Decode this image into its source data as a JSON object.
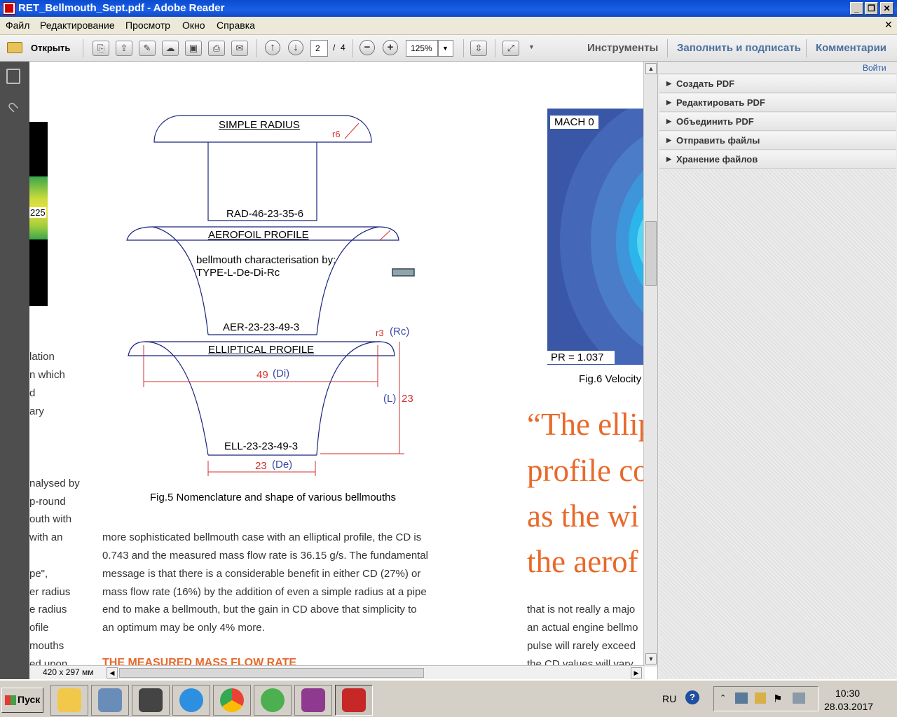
{
  "window": {
    "title": "RET_Bellmouth_Sept.pdf - Adobe Reader",
    "controls": {
      "minimize": "_",
      "restore": "❐",
      "close": "✕"
    }
  },
  "menu": [
    "Файл",
    "Редактирование",
    "Просмотр",
    "Окно",
    "Справка"
  ],
  "toolbar": {
    "open_label": "Открыть",
    "page_current": "2",
    "page_sep": "/",
    "page_total": "4",
    "zoom": "125%",
    "tools_label": "Инструменты",
    "fill_sign_label": "Заполнить и подписать",
    "comments_label": "Комментарии"
  },
  "right_pane": {
    "signin": "Войти",
    "items": [
      "Создать PDF",
      "Редактировать PDF",
      "Объединить PDF",
      "Отправить файлы",
      "Хранение файлов"
    ]
  },
  "document": {
    "left_partial_lines": [
      "lation",
      "n which",
      "d",
      "ary",
      "nalysed by",
      "p-round",
      "outh with",
      "with an",
      "pe\",",
      "er radius",
      "e radius",
      "ofile",
      "mouths",
      "ed upon"
    ],
    "colorbar_label": "225",
    "figure5": {
      "simple_radius": "SIMPLE RADIUS",
      "r6": "r6",
      "rad_code": "RAD-46-23-35-6",
      "aerofoil": "AEROFOIL PROFILE",
      "char_line1": "bellmouth characterisation by:",
      "char_line2": "TYPE-L-De-Di-Rc",
      "aer_code": "AER-23-23-49-3",
      "elliptical": "ELLIPTICAL PROFILE",
      "r3": "r3",
      "rc": "(Rc)",
      "di_val": "49",
      "di": "(Di)",
      "l": "(L)",
      "l_val": "23",
      "ell_code": "ELL-23-23-49-3",
      "de_val": "23",
      "de": "(De)",
      "caption": "Fig.5 Nomenclature and shape of various bellmouths"
    },
    "body_lines": [
      "more sophisticated bellmouth case with an elliptical profile, the CD is",
      "0.743 and the measured mass flow rate is 36.15 g/s. The fundamental",
      "message is that there is a considerable benefit in either CD (27%) or",
      "mass flow rate (16%) by the addition of even a simple radius at a pipe",
      "end to make a bellmouth, but the gain in CD above that simplicity to",
      "an optimum may be only 4% more."
    ],
    "section_heading": "THE MEASURED MASS FLOW RATE",
    "figure6": {
      "mach": "MACH 0",
      "pr": "PR = 1.037",
      "caption": "Fig.6 Velocity"
    },
    "quote_lines": [
      "“The ellip",
      "profile co",
      "as the wi",
      "the aerof"
    ],
    "right_body_lines": [
      "that is not really a majo",
      "an actual engine bellmo",
      "pulse will rarely exceed",
      "the CD values will vary"
    ]
  },
  "status": {
    "page_size": "420 x 297 мм"
  },
  "taskbar": {
    "start": "Пуск",
    "lang": "RU",
    "time": "10:30",
    "date": "28.03.2017"
  }
}
